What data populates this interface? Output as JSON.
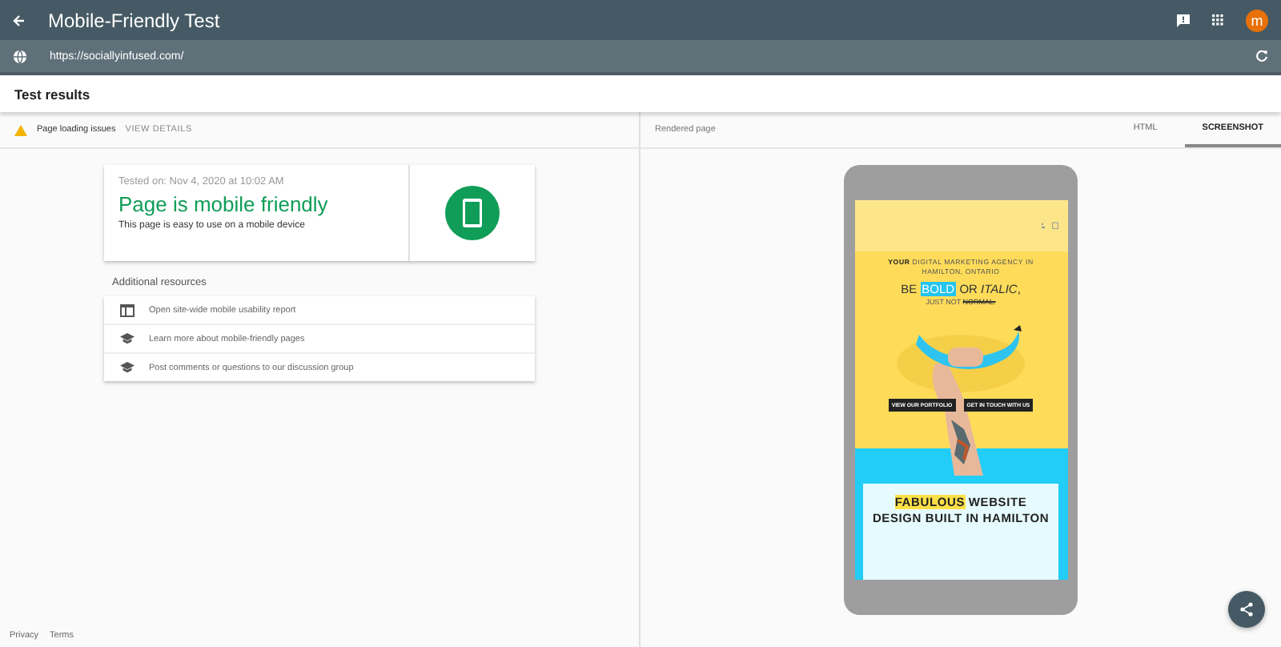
{
  "app_bar": {
    "title": "Mobile-Friendly Test",
    "avatar": "m"
  },
  "url_bar": {
    "value": "https://sociallyinfused.com/"
  },
  "section_title": "Test results",
  "issues": {
    "label": "Page loading issues",
    "action": "VIEW DETAILS"
  },
  "result": {
    "tested_on": "Tested on: Nov 4, 2020 at 10:02 AM",
    "headline": "Page is mobile friendly",
    "description": "This page is easy to use on a mobile device"
  },
  "resources": {
    "title": "Additional resources",
    "items": [
      {
        "kind": "report",
        "label": "Open site-wide mobile usability report"
      },
      {
        "kind": "learn",
        "label": "Learn more about mobile-friendly pages"
      },
      {
        "kind": "learn",
        "label": "Post comments or questions to our discussion group"
      }
    ]
  },
  "rendered": {
    "title": "Rendered page",
    "tabs": [
      {
        "label": "HTML",
        "selected": false
      },
      {
        "label": "SCREENSHOT",
        "selected": true
      }
    ]
  },
  "screenshot": {
    "intro": "**YOUR** DIGITAL MARKETING AGENCY IN HAMILTON, ONTARIO",
    "headline": "BE **BOLD** OR *ITALIC*,",
    "subline": "JUST NOT",
    "struck": "NORMAL.",
    "buttons": [
      "VIEW OUR PORTFOLIO",
      "GET IN TOUCH WITH US"
    ],
    "card": "**FABULOUS** WEBSITE DESIGN BUILT IN HAMILTON"
  },
  "footer": {
    "links": [
      "Privacy",
      "Terms"
    ]
  }
}
